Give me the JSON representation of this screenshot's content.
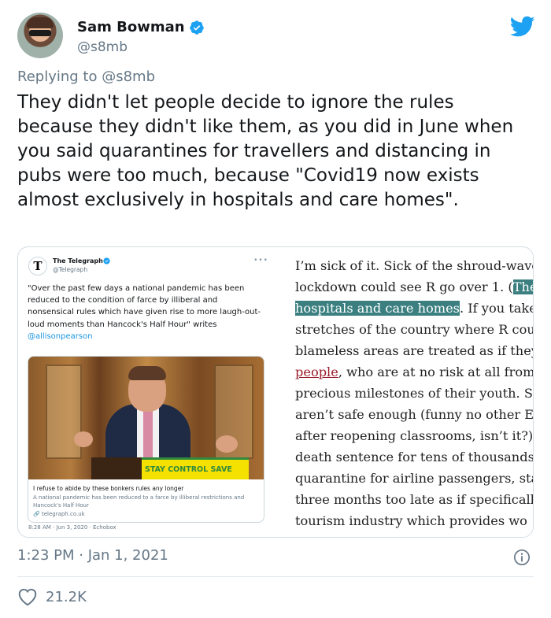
{
  "author": {
    "display_name": "Sam Bowman",
    "handle": "@s8mb",
    "verified": true
  },
  "replying_to": {
    "prefix": "Replying to ",
    "mention": "@s8mb"
  },
  "tweet_text": "They didn't let people decide to ignore the rules because they didn't like them, as you did in June when you said quarantines for travellers and distancing in pubs were too much, because \"Covid19 now exists almost exclusively in hospitals and care homes\".",
  "embedded_tweet": {
    "display_name": "The Telegraph",
    "handle": "@Telegraph",
    "text": "\"Over the past few days a national pandemic has been reduced to the condition of farce by illiberal and nonsensical rules which have given rise to more laugh-out-loud moments than Hancock's Half Hour\" writes ",
    "mention": "@allisonpearson",
    "card": {
      "slogan": "STAY  CONTROL  SAVE",
      "title": "I refuse to abide by these bonkers rules any longer",
      "description": "A national pandemic has been reduced to a farce by illiberal restrictions and Hancock's Half Hour",
      "domain": "telegraph.co.uk"
    },
    "timestamp": "8:28 AM · Jun 3, 2020 · Echobox"
  },
  "article_lines": [
    {
      "pre": "I’m sick of it. Sick of the shroud-wave",
      "hl": "",
      "red": "",
      "post": ""
    },
    {
      "pre": "lockdown could see R go over 1. (",
      "hl": "The",
      "red": "",
      "post": ""
    },
    {
      "pre": "",
      "hl": "hospitals and care homes",
      "red": "",
      "post": ". If you take"
    },
    {
      "pre": "stretches of the country where R cou",
      "hl": "",
      "red": "",
      "post": ""
    },
    {
      "pre": "blameless areas are treated as if they’",
      "hl": "",
      "red": "",
      "post": ""
    },
    {
      "pre": "",
      "hl": "",
      "red": "people",
      "post": ", who are at no risk at all from"
    },
    {
      "pre": "precious milestones of their youth. Si",
      "hl": "",
      "red": "",
      "post": ""
    },
    {
      "pre": "aren’t safe enough (funny no other Eu",
      "hl": "",
      "red": "",
      "post": ""
    },
    {
      "pre": "after reopening classrooms, isn’t it?).",
      "hl": "",
      "red": "",
      "post": ""
    },
    {
      "pre": "death sentence for tens of thousands",
      "hl": "",
      "red": "",
      "post": ""
    },
    {
      "pre": "quarantine for airline passengers, sta",
      "hl": "",
      "red": "",
      "post": ""
    },
    {
      "pre": "three months too late as if specificall",
      "hl": "",
      "red": "",
      "post": ""
    },
    {
      "pre": "tourism industry which provides wo",
      "hl": "",
      "red": "",
      "post": ""
    }
  ],
  "timestamp": "1:23 PM · Jan 1, 2021",
  "likes": "21.2K",
  "colors": {
    "twitter_blue": "#1da1f2",
    "secondary_text": "#657786",
    "highlight": "#3b7f80",
    "article_link": "#9a1d2a"
  }
}
